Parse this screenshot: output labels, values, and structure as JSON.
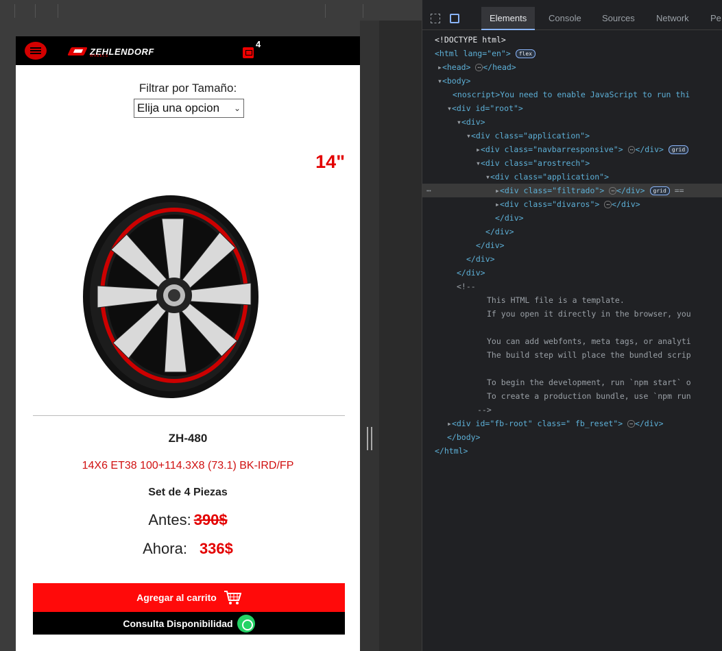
{
  "navbar": {
    "cart_count": "4",
    "logo_text": "ZEHLENDORF",
    "logo_sub": "WHEELS"
  },
  "filter": {
    "label": "Filtrar por Tamaño:",
    "selected": "Elija una opcion"
  },
  "product": {
    "size": "14\"",
    "model": "ZH-480",
    "spec": "14X6 ET38 100+114.3X8 (73.1) BK-IRD/FP",
    "set": "Set de 4 Piezas",
    "before_label": "Antes:",
    "before_price": "390$",
    "now_label": "Ahora:",
    "now_price": "336$"
  },
  "buttons": {
    "add_to_cart": "Agregar al carrito",
    "availability": "Consulta Disponibilidad"
  },
  "devtools": {
    "tabs": [
      "Elements",
      "Console",
      "Sources",
      "Network",
      "Pe"
    ],
    "active_tab": "Elements",
    "lines": [
      "<!DOCTYPE html>",
      "<html lang=\"en\">",
      "<head>",
      "<body>",
      "<noscript>You need to enable JavaScript to run thi",
      "<div id=\"root\">",
      "<div>",
      "<div class=\"application\">",
      "<div class=\"navbarresponsive\">",
      "<div class=\"arostrech\">",
      "<div class=\"application\">",
      "<div class=\"filtrado\">",
      "<div class=\"divaros\">",
      "This HTML file is a template.",
      "If you open it directly in the browser, you",
      "You can add webfonts, meta tags, or analyti",
      "The build step will place the bundled scrip",
      "To begin the development, run `npm start` o",
      "To create a production bundle, use `npm run",
      "<div id=\"fb-root\" class=\" fb_reset\">"
    ]
  },
  "colors": {
    "accent": "#e30000",
    "devtools_bg": "#202124",
    "tag": "#5db0d7",
    "attr_value": "#f29766"
  }
}
